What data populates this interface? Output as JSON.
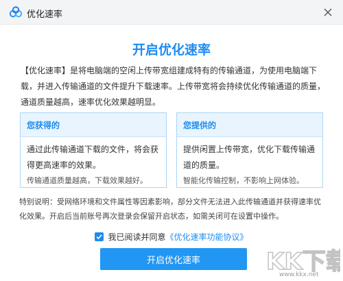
{
  "window": {
    "title": "优化速率",
    "close_icon": "close-icon"
  },
  "main": {
    "heading": "开启优化速率",
    "intro": "【优化速率】是将电脑端的空闲上传带宽组建成特有的传输通道，为使用电脑端下载，并进入传输通道的文件提升下载速率。上传带宽将会持续优化传输通道的质量，通道质量越高，速率优化效果越明显。"
  },
  "cards": {
    "gain": {
      "title": "您获得的",
      "body": "通过此传输通道下载的文件，将会获得更高速率的效果。",
      "note": "传输通道质量越高，下载效果越好。"
    },
    "provide": {
      "title": "您提供的",
      "body": "提供闲置上传带宽，优化下载传输通道的质量。",
      "note": "智能化传输控制，不影响上网体验。"
    }
  },
  "notice": "特别说明：受网络环境和文件属性等因素影响，部分文件无法进入此传输通道并获得速率优化效果。开启后当前账号再次登录会保留开启状态，如需关闭可在设置中操作。",
  "agreement": {
    "checked": true,
    "text": "我已阅读并同意",
    "link": "《优化速率功能协议》"
  },
  "actions": {
    "enable_label": "开启优化速率"
  },
  "watermark": {
    "logo_text": "KK下载",
    "site": "www.kkx.net"
  },
  "colors": {
    "accent": "#1e8cf0",
    "button": "#2196f3",
    "card_border": "#a9d4f7",
    "card_head_bg": "#e9f5fe"
  }
}
